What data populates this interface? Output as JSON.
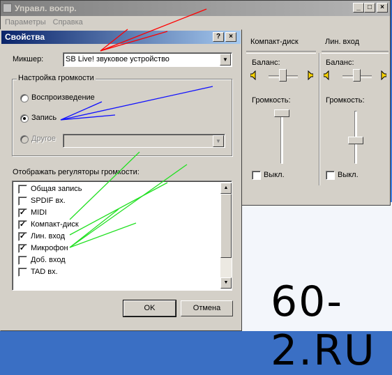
{
  "mixer_window": {
    "title": "Управл. воспр.",
    "menu": [
      "Параметры",
      "Справка"
    ],
    "title_buttons": [
      "_",
      "□",
      "×"
    ],
    "columns": [
      {
        "name": "Компакт-диск",
        "balance_label": "Баланс:",
        "volume_label": "Громкость:",
        "mute_label": "Выкл."
      },
      {
        "name": "Лин. вход",
        "balance_label": "Баланс:",
        "volume_label": "Громкость:",
        "mute_label": "Выкл."
      }
    ]
  },
  "dialog": {
    "title": "Свойства",
    "title_buttons": [
      "?",
      "×"
    ],
    "mixer_label": "Микшер:",
    "mixer_value": "SB Live! звуковое устройство",
    "volume_group_label": "Настройка громкости",
    "radios": [
      {
        "label": "Воспроизведение",
        "selected": false,
        "disabled": false
      },
      {
        "label": "Запись",
        "selected": true,
        "disabled": false
      },
      {
        "label": "Другое",
        "selected": false,
        "disabled": true
      }
    ],
    "show_controls_label": "Отображать регуляторы громкости:",
    "controls": [
      {
        "label": "Общая запись",
        "checked": false
      },
      {
        "label": "SPDIF вх.",
        "checked": false
      },
      {
        "label": "MIDI",
        "checked": true
      },
      {
        "label": "Компакт-диск",
        "checked": true
      },
      {
        "label": "Лин. вход",
        "checked": true
      },
      {
        "label": "Микрофон",
        "checked": true
      },
      {
        "label": "Доб. вход",
        "checked": false
      },
      {
        "label": "TAD вх.",
        "checked": false
      }
    ],
    "ok_label": "OK",
    "cancel_label": "Отмена"
  },
  "watermark": "60-2.RU",
  "annotation_colors": {
    "red": "#ff0000",
    "blue": "#1010ff",
    "green": "#22e022"
  }
}
